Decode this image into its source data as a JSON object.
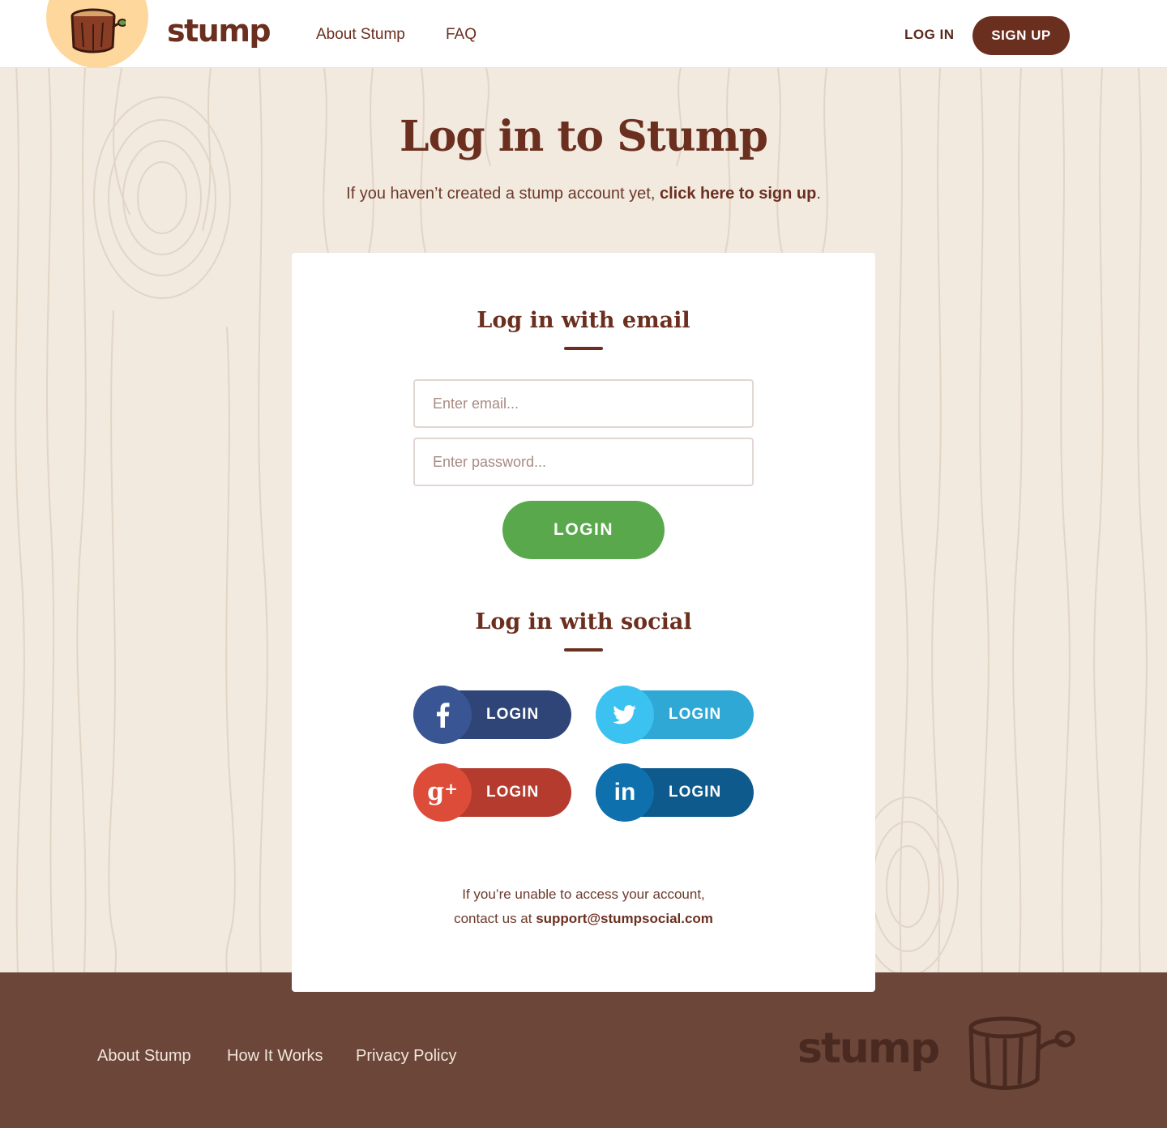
{
  "header": {
    "brand": "stump",
    "nav": [
      {
        "label": "About Stump"
      },
      {
        "label": "FAQ"
      }
    ],
    "login_label": "LOG IN",
    "signup_label": "SIGN UP"
  },
  "hero": {
    "title": "Log in to Stump",
    "subtitle_prefix": "If you haven’t created a stump account yet, ",
    "subtitle_link": "click here to sign up",
    "subtitle_suffix": "."
  },
  "card": {
    "email_section_title": "Log in with email",
    "email_placeholder": "Enter email...",
    "password_placeholder": "Enter password...",
    "login_button": "LOGIN",
    "social_section_title": "Log in with social",
    "social": [
      {
        "icon": "facebook-icon",
        "label": "LOGIN",
        "color": "#3a5593"
      },
      {
        "icon": "twitter-icon",
        "label": "LOGIN",
        "color": "#3cc2f0"
      },
      {
        "icon": "google-plus-icon",
        "label": "LOGIN",
        "color": "#dd4b39"
      },
      {
        "icon": "linkedin-icon",
        "label": "LOGIN",
        "color": "#0e70ad"
      }
    ],
    "help_line1": "If you’re unable to access your account,",
    "help_line2_prefix": "contact us at ",
    "help_email": "support@stumpsocial.com"
  },
  "footer": {
    "links": [
      {
        "label": "About Stump"
      },
      {
        "label": "How It Works"
      },
      {
        "label": "Privacy Policy"
      }
    ],
    "brand": "stump"
  },
  "colors": {
    "brand_brown": "#6b2f1f",
    "login_green": "#59a84b",
    "footer_brown": "#6b4639",
    "background": "#f2e9df"
  }
}
